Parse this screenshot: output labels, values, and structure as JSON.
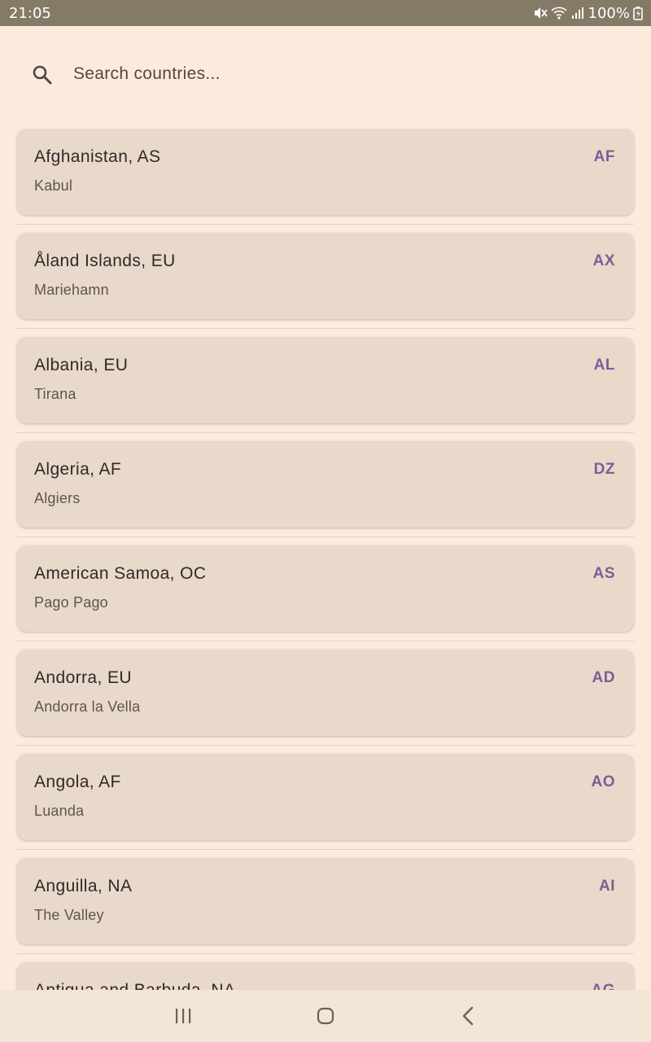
{
  "status": {
    "time": "21:05",
    "battery": "100%",
    "icons": [
      "mute-icon",
      "wifi-icon",
      "signal-icon",
      "battery-charging-icon"
    ]
  },
  "search": {
    "placeholder": "Search countries...",
    "value": "",
    "icon": "search-icon"
  },
  "countries": [
    {
      "name": "Afghanistan, AS",
      "capital": "Kabul",
      "code": "AF"
    },
    {
      "name": "Åland Islands, EU",
      "capital": "Mariehamn",
      "code": "AX"
    },
    {
      "name": "Albania, EU",
      "capital": "Tirana",
      "code": "AL"
    },
    {
      "name": "Algeria, AF",
      "capital": "Algiers",
      "code": "DZ"
    },
    {
      "name": "American Samoa, OC",
      "capital": "Pago Pago",
      "code": "AS"
    },
    {
      "name": "Andorra, EU",
      "capital": "Andorra la Vella",
      "code": "AD"
    },
    {
      "name": "Angola, AF",
      "capital": "Luanda",
      "code": "AO"
    },
    {
      "name": "Anguilla, NA",
      "capital": "The Valley",
      "code": "AI"
    },
    {
      "name": "Antigua and Barbuda, NA",
      "capital": "",
      "code": "AG"
    }
  ],
  "colors": {
    "background": "#fcebdc",
    "card": "#e8d9cb",
    "code_accent": "#7a5e96",
    "status_bar": "#857a65"
  },
  "nav": {
    "icons": [
      "recent-apps-icon",
      "home-icon",
      "back-icon"
    ]
  }
}
